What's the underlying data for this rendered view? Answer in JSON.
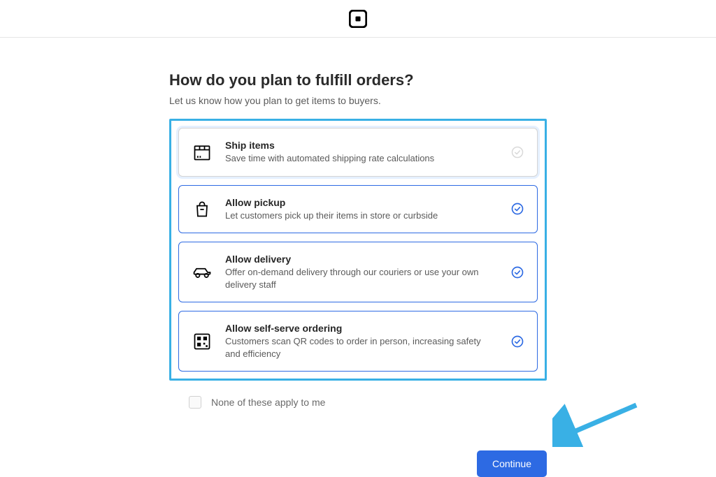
{
  "page": {
    "title": "How do you plan to fulfill orders?",
    "subtitle": "Let us know how you plan to get items to buyers."
  },
  "options": [
    {
      "id": "ship",
      "title": "Ship items",
      "desc": "Save time with automated shipping rate calculations",
      "selected": false
    },
    {
      "id": "pickup",
      "title": "Allow pickup",
      "desc": "Let customers pick up their items in store or curbside",
      "selected": true
    },
    {
      "id": "delivery",
      "title": "Allow delivery",
      "desc": "Offer on-demand delivery through our couriers or use your own delivery staff",
      "selected": true
    },
    {
      "id": "selfserve",
      "title": "Allow self-serve ordering",
      "desc": "Customers scan QR codes to order in person, increasing safety and efficiency",
      "selected": true
    }
  ],
  "none_label": "None of these apply to me",
  "continue_label": "Continue"
}
